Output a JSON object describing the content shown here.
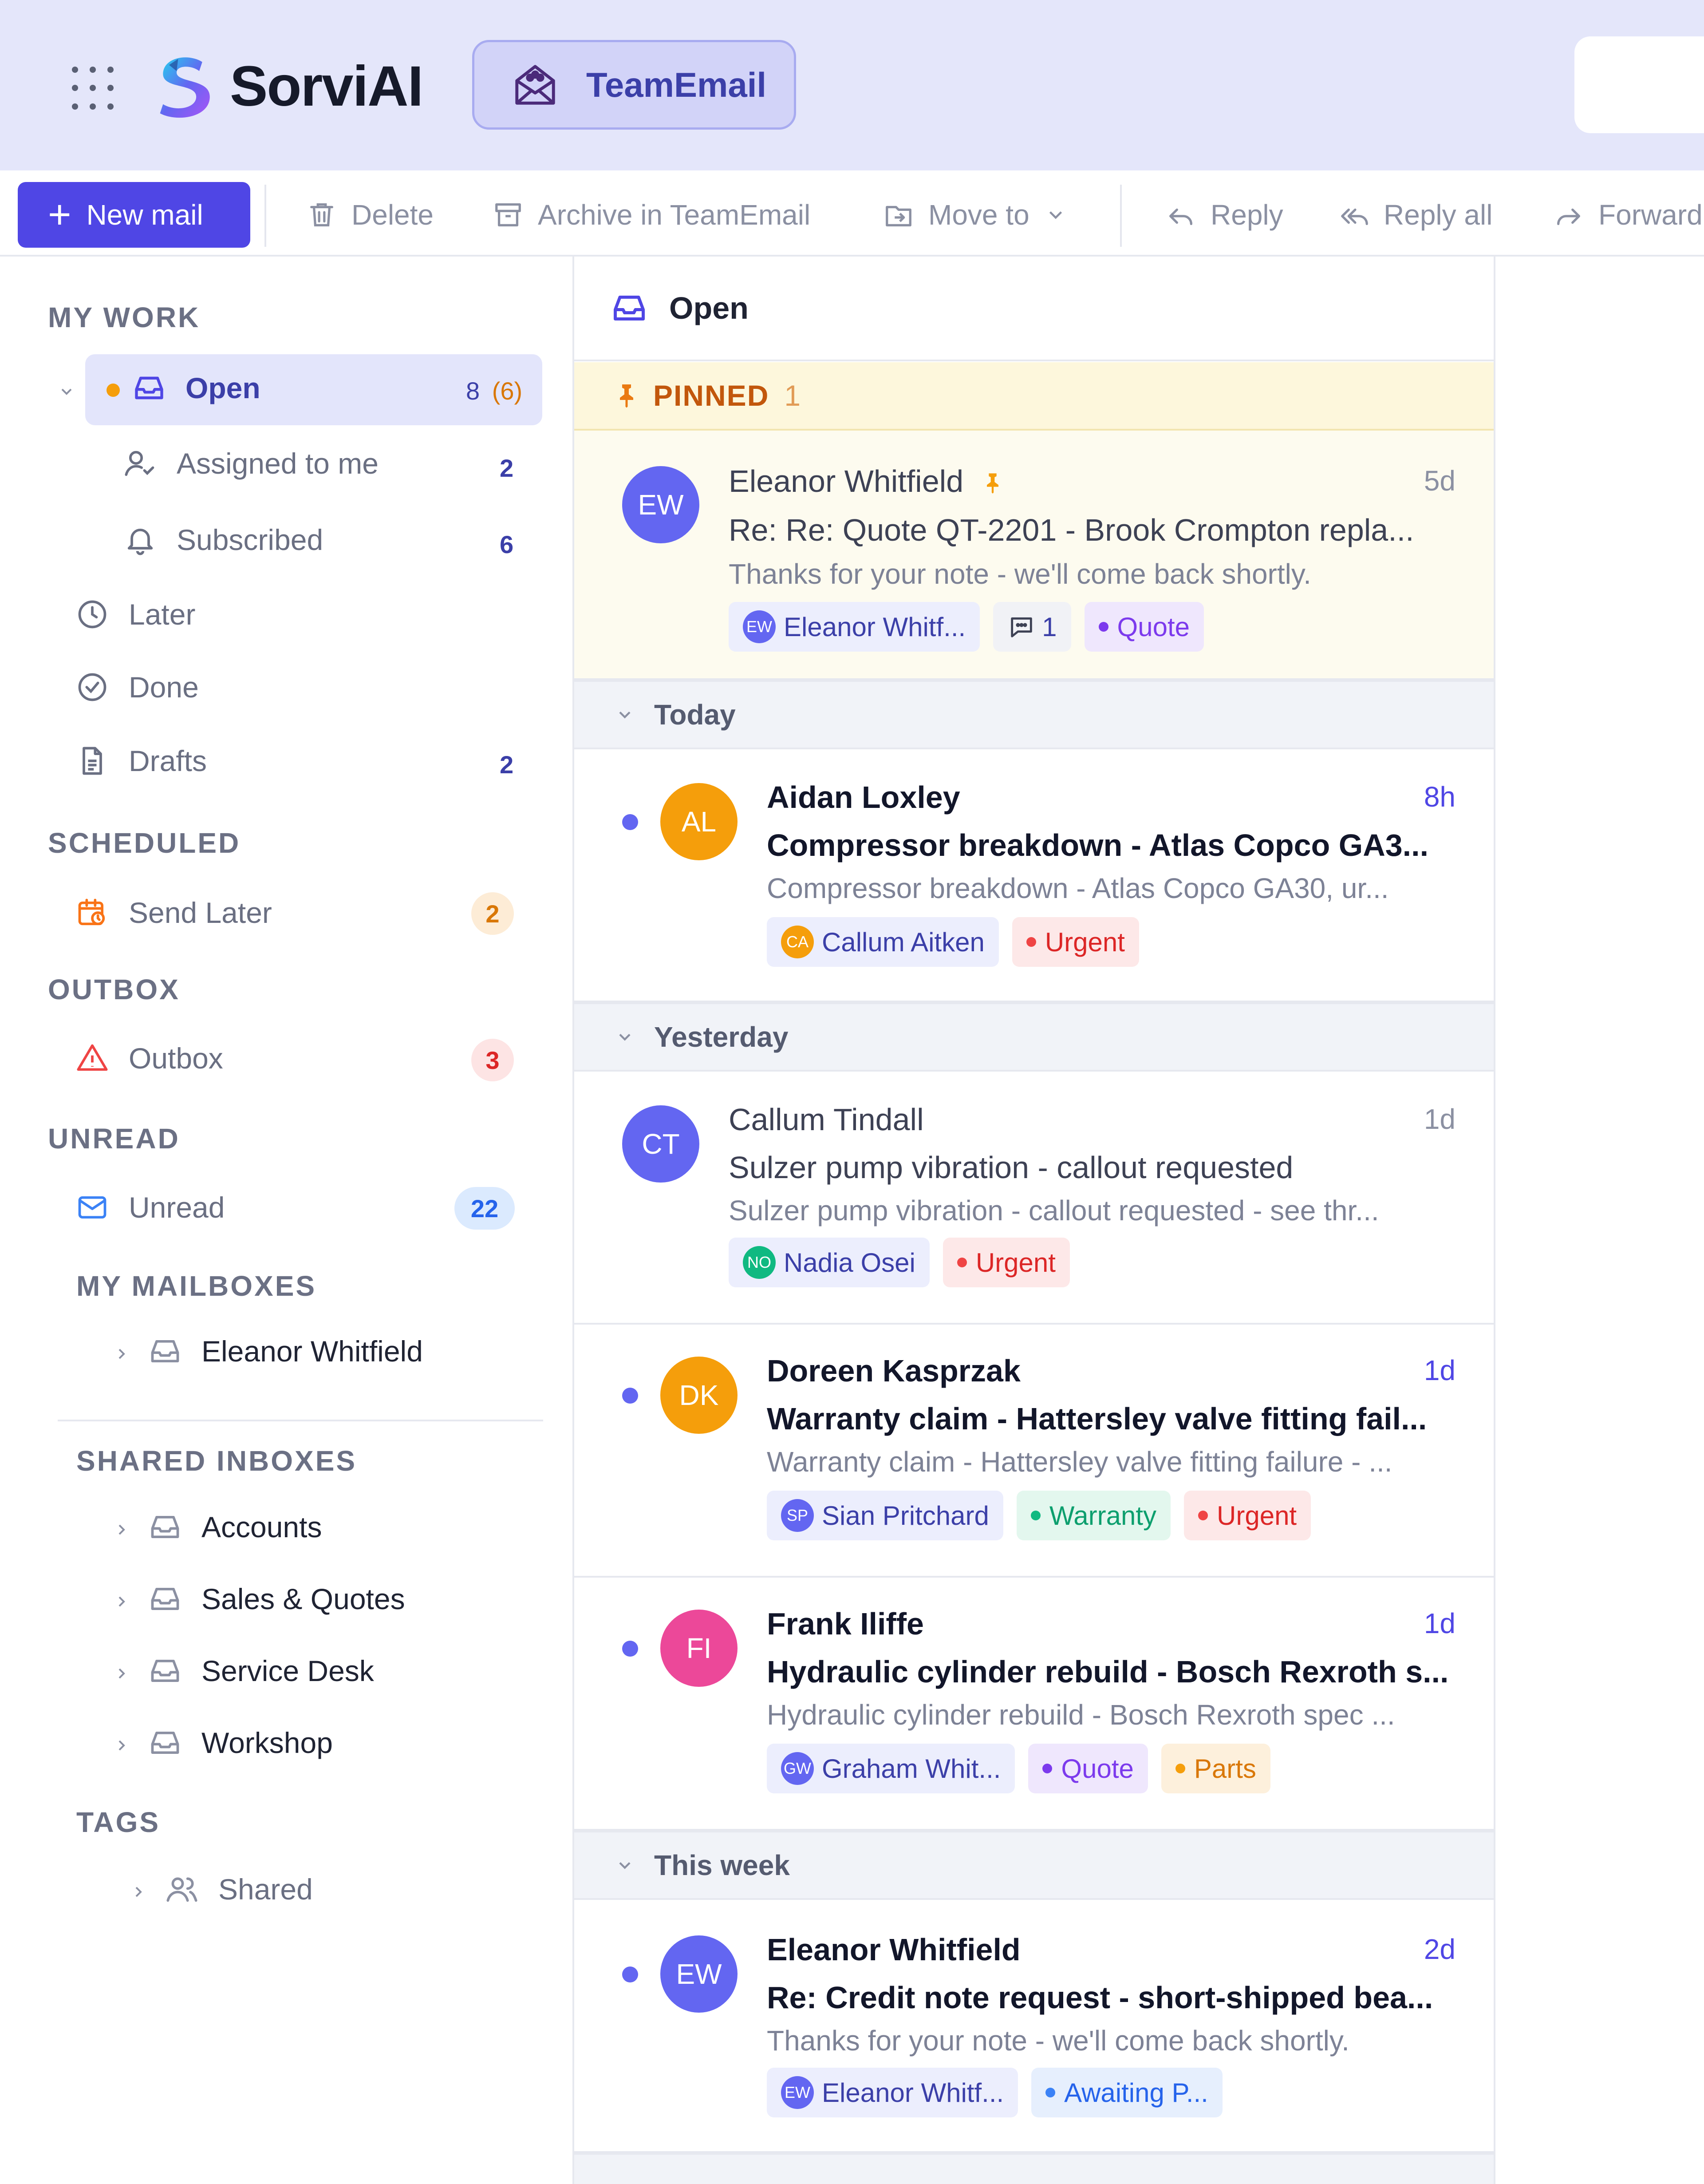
{
  "header": {
    "brand": "SorviAI",
    "team_pill": "TeamEmail"
  },
  "toolbar": {
    "new_mail": "New mail",
    "delete": "Delete",
    "archive": "Archive in TeamEmail",
    "move_to": "Move to",
    "reply": "Reply",
    "reply_all": "Reply all",
    "forward": "Forward"
  },
  "sidebar": {
    "my_work": "MY WORK",
    "open": {
      "label": "Open",
      "count": "8",
      "count_sub": "(6)"
    },
    "assigned": {
      "label": "Assigned to me",
      "count": "2"
    },
    "subscribed": {
      "label": "Subscribed",
      "count": "6"
    },
    "later": {
      "label": "Later"
    },
    "done": {
      "label": "Done"
    },
    "drafts": {
      "label": "Drafts",
      "count": "2"
    },
    "scheduled": "SCHEDULED",
    "send_later": {
      "label": "Send Later",
      "count": "2"
    },
    "outbox_h": "OUTBOX",
    "outbox": {
      "label": "Outbox",
      "count": "3"
    },
    "unread_h": "UNREAD",
    "unread": {
      "label": "Unread",
      "count": "22"
    },
    "my_mailboxes": "MY MAILBOXES",
    "mailbox_eleanor": "Eleanor Whitfield",
    "shared_inboxes": "SHARED INBOXES",
    "shared": [
      "Accounts",
      "Sales & Quotes",
      "Service Desk",
      "Workshop"
    ],
    "tags": "TAGS",
    "tag_shared": "Shared"
  },
  "list": {
    "title": "Open",
    "pinned_label": "PINNED",
    "pinned_count": "1",
    "groups": {
      "today": "Today",
      "yesterday": "Yesterday",
      "this_week": "This week"
    },
    "messages": [
      {
        "initials": "EW",
        "sender": "Eleanor Whitfield",
        "time": "5d",
        "subject": "Re: Re: Quote QT-2201 - Brook Crompton repla...",
        "preview": "Thanks for your note - we'll come back shortly.",
        "chips": {
          "person_initials": "EW",
          "person": "Eleanor Whitf...",
          "comments": "1",
          "tag1": "Quote"
        }
      },
      {
        "initials": "AL",
        "sender": "Aidan Loxley",
        "time": "8h",
        "subject": "Compressor breakdown - Atlas Copco GA3...",
        "preview": "Compressor breakdown - Atlas Copco GA30, ur...",
        "chips": {
          "person_initials": "CA",
          "person": "Callum Aitken",
          "tag1": "Urgent"
        }
      },
      {
        "initials": "CT",
        "sender": "Callum Tindall",
        "time": "1d",
        "subject": "Sulzer pump vibration - callout requested",
        "preview": "Sulzer pump vibration - callout requested - see thr...",
        "chips": {
          "person_initials": "NO",
          "person": "Nadia Osei",
          "tag1": "Urgent"
        }
      },
      {
        "initials": "DK",
        "sender": "Doreen Kasprzak",
        "time": "1d",
        "subject": "Warranty claim - Hattersley valve fitting fail...",
        "preview": "Warranty claim - Hattersley valve fitting failure - ...",
        "chips": {
          "person_initials": "SP",
          "person": "Sian Pritchard",
          "tag1": "Warranty",
          "tag2": "Urgent"
        }
      },
      {
        "initials": "FI",
        "sender": "Frank Iliffe",
        "time": "1d",
        "subject": "Hydraulic cylinder rebuild - Bosch Rexroth s...",
        "preview": "Hydraulic cylinder rebuild - Bosch Rexroth spec ...",
        "chips": {
          "person_initials": "GW",
          "person": "Graham Whit...",
          "tag1": "Quote",
          "tag2": "Parts"
        }
      },
      {
        "initials": "EW",
        "sender": "Eleanor Whitfield",
        "time": "2d",
        "subject": "Re: Credit note request - short-shipped bea...",
        "preview": "Thanks for your note - we'll come back shortly.",
        "chips": {
          "person_initials": "EW",
          "person": "Eleanor Whitf...",
          "tag1": "Awaiting P..."
        }
      }
    ]
  },
  "colors": {
    "accent": "#4f46e5",
    "header_bg": "#e4e6fa",
    "avatar_indigo": "#6366f1",
    "avatar_amber": "#f59e0b",
    "avatar_pink": "#ec4899",
    "green": "#10b981"
  }
}
